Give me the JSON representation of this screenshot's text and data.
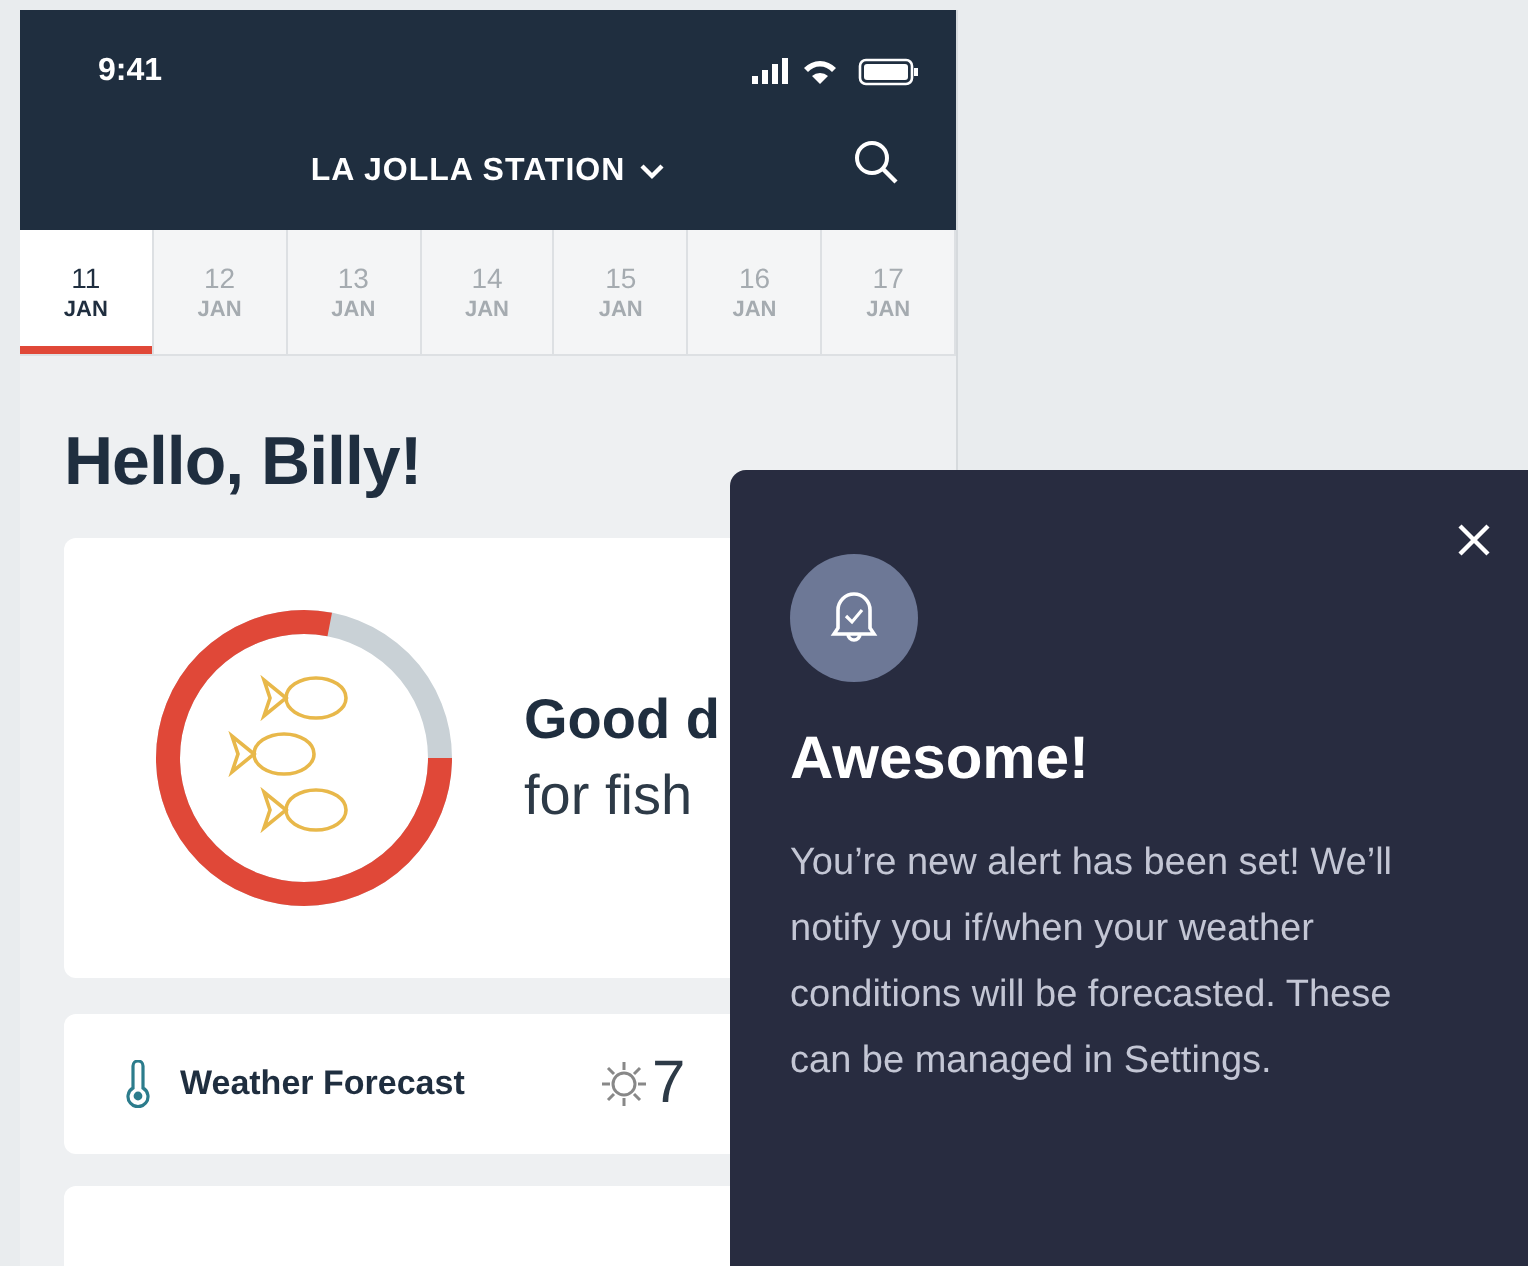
{
  "status_bar": {
    "time": "9:41"
  },
  "header": {
    "station": "LA JOLLA STATION"
  },
  "date_tabs": [
    {
      "day": "11",
      "month": "JAN",
      "selected": true
    },
    {
      "day": "12",
      "month": "JAN",
      "selected": false
    },
    {
      "day": "13",
      "month": "JAN",
      "selected": false
    },
    {
      "day": "14",
      "month": "JAN",
      "selected": false
    },
    {
      "day": "15",
      "month": "JAN",
      "selected": false
    },
    {
      "day": "16",
      "month": "JAN",
      "selected": false
    },
    {
      "day": "17",
      "month": "JAN",
      "selected": false
    }
  ],
  "greeting": "Hello, Billy!",
  "fishing_card": {
    "level": 0.78,
    "title": "Good d",
    "subtitle": "for fish"
  },
  "rows": [
    {
      "label": "Weather Forecast",
      "value": "7"
    }
  ],
  "alert": {
    "title": "Awesome!",
    "message": "You’re new alert has been set! We’ll notify you if/when your weather conditions will be forecasted. These can be managed in Settings."
  }
}
